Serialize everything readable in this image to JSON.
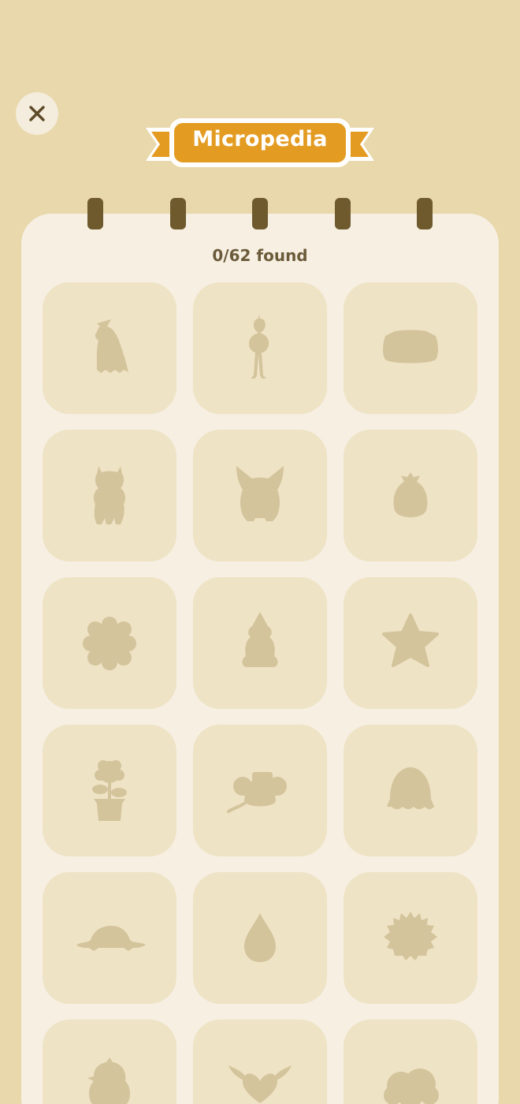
{
  "header": {
    "close_icon": "close-icon",
    "title": "Micropedia",
    "banner_color": "#e39b22"
  },
  "collection": {
    "found_text": "0/62 found",
    "items": [
      {
        "name": "witch-ghost-silhouette"
      },
      {
        "name": "bird-silhouette"
      },
      {
        "name": "cat-blob-silhouette"
      },
      {
        "name": "alpaca-silhouette"
      },
      {
        "name": "fox-silhouette"
      },
      {
        "name": "fruit-silhouette"
      },
      {
        "name": "flower-blob-silhouette"
      },
      {
        "name": "gnome-silhouette"
      },
      {
        "name": "star-silhouette"
      },
      {
        "name": "potted-flower-silhouette"
      },
      {
        "name": "mouse-silhouette"
      },
      {
        "name": "jelly-silhouette"
      },
      {
        "name": "turtle-silhouette"
      },
      {
        "name": "drop-silhouette"
      },
      {
        "name": "fuzzball-silhouette"
      },
      {
        "name": "chick-silhouette"
      },
      {
        "name": "winged-heart-silhouette"
      },
      {
        "name": "cloud-silhouette"
      }
    ]
  },
  "colors": {
    "background": "#e8d8ab",
    "notebook": "#f6efe2",
    "tile": "#efe3c5",
    "silhouette": "#d3c49c",
    "ring": "#6e5a2d"
  }
}
